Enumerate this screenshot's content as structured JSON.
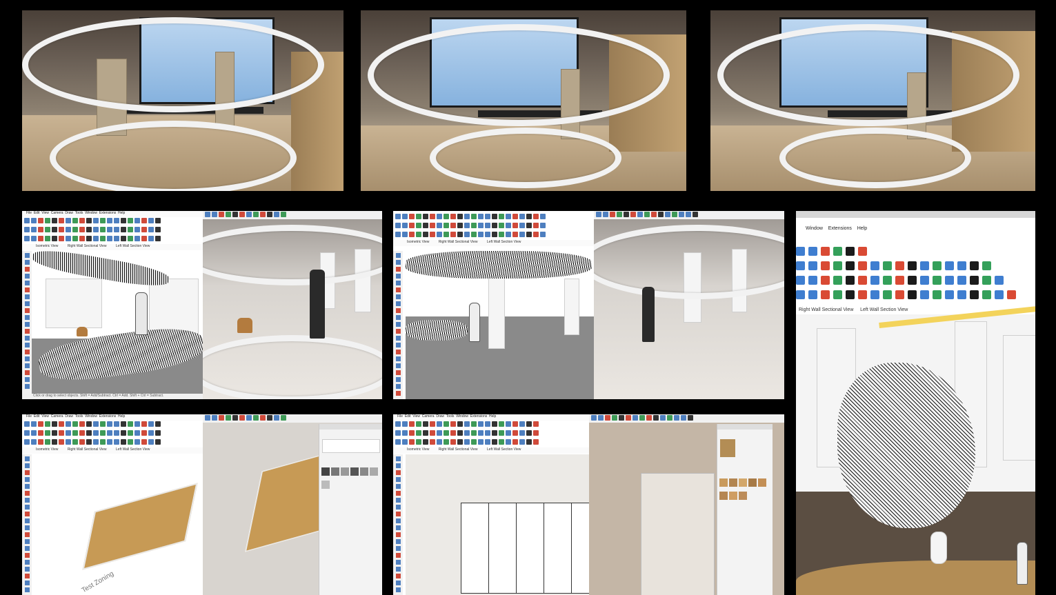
{
  "panel_sketchup_iso": {
    "menu": [
      "File",
      "Edit",
      "View",
      "Camera",
      "Draw",
      "Tools",
      "Window",
      "Extensions",
      "Help"
    ],
    "scene_tabs": [
      "Isometric View",
      "Right Wall Sectional View",
      "Left Wall Section View"
    ],
    "status": "Click or drag to select objects. Shift = Add/Subtract. Ctrl = Add. Shift + Ctrl = Subtract.",
    "label": "Test Zoning"
  },
  "panel_sketchup_wall": {
    "scene_tabs": [
      "Isometric View",
      "Right Wall Sectional View",
      "Left Wall Section View"
    ]
  },
  "panel_zoom": {
    "menu": [
      "Window",
      "Extensions",
      "Help"
    ],
    "scene_tabs": [
      "Right Wall Sectional View",
      "Left Wall Section View"
    ]
  },
  "colors": {
    "accent": "#3f7ed0",
    "danger": "#d94a34",
    "plan": "#c79a55"
  }
}
